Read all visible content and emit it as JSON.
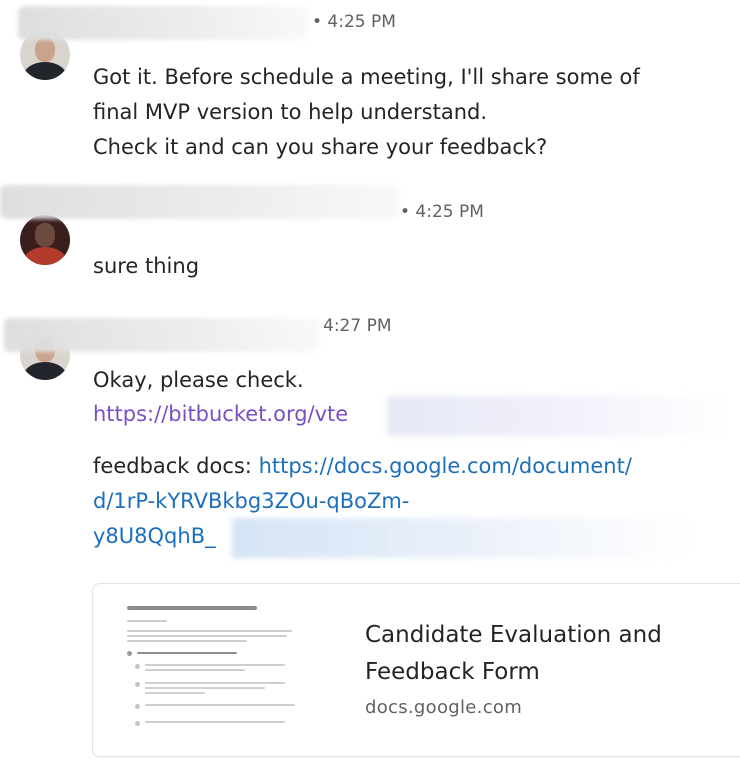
{
  "messages": [
    {
      "time": "• 4:25 PM",
      "lines": [
        "Got it. Before schedule a meeting, I'll share some of",
        "final MVP version to help understand.",
        "Check it and can you share your feedback?"
      ]
    },
    {
      "time": "• 4:25 PM",
      "lines": [
        "sure thing"
      ]
    },
    {
      "time": "4:27 PM",
      "text": "Okay, please check.",
      "bitbucket_link": "https://bitbucket.org/vte",
      "feedback_label": "feedback docs: ",
      "doc_link_lines": [
        "https://docs.google.com/document/",
        "d/1rP-kYRVBkbg3ZOu-qBoZm-",
        "y8U8QqhB_"
      ],
      "preview": {
        "title": "Candidate Evaluation and Feedback Form",
        "domain": "docs.google.com"
      }
    }
  ],
  "colors": {
    "link_visited": "#7b4fc4",
    "link": "#1c6fbd",
    "text": "#242424",
    "meta": "#616161"
  },
  "icons": [
    "avatar-person",
    "avatar-person-dark"
  ]
}
